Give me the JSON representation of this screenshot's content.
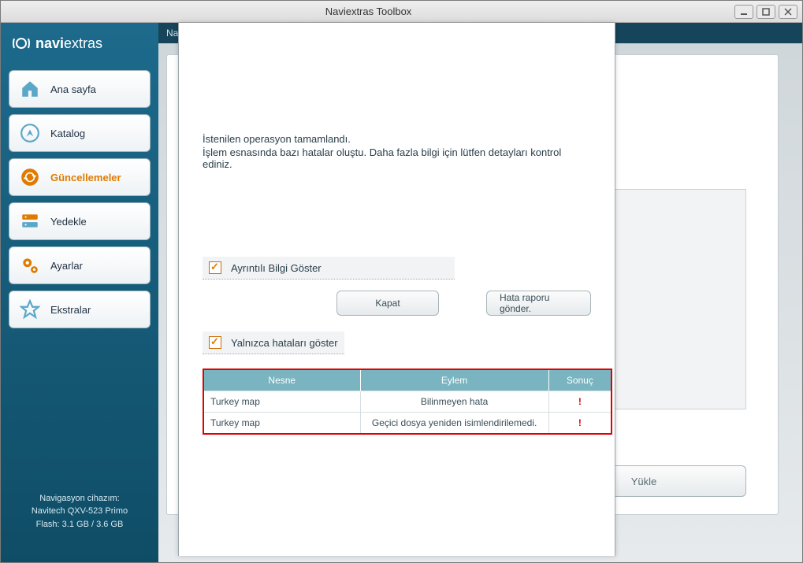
{
  "window": {
    "title": "Naviextras Toolbox"
  },
  "brand": {
    "part1": "navi",
    "part2": "extras"
  },
  "sidebar": {
    "items": [
      {
        "label": "Ana sayfa"
      },
      {
        "label": "Katalog"
      },
      {
        "label": "Güncellemeler"
      },
      {
        "label": "Yedekle"
      },
      {
        "label": "Ayarlar"
      },
      {
        "label": "Ekstralar"
      }
    ],
    "device": {
      "line1": "Navigasyon cihazım:",
      "line2": "Navitech QXV-523 Primo",
      "line3": "Flash: 3.1 GB / 3.6 GB"
    }
  },
  "main": {
    "header": "Nav",
    "install_label": "Yükle"
  },
  "modal": {
    "msg1": "İstenilen operasyon tamamlandı.",
    "msg2": "İşlem esnasında bazı hatalar oluştu. Daha fazla bilgi için lütfen detayları kontrol ediniz.",
    "check_details": "Ayrıntılı Bilgi Göster",
    "check_errors_only": "Yalnızca hataları göster",
    "btn_close": "Kapat",
    "btn_report": "Hata raporu gönder.",
    "table": {
      "headers": {
        "object": "Nesne",
        "action": "Eylem",
        "result": "Sonuç"
      },
      "rows": [
        {
          "object": "Turkey map",
          "action": "Bilinmeyen hata",
          "result": "!"
        },
        {
          "object": "Turkey map",
          "action": "Geçici dosya yeniden isimlendirilemedi.",
          "result": "!"
        }
      ]
    }
  }
}
